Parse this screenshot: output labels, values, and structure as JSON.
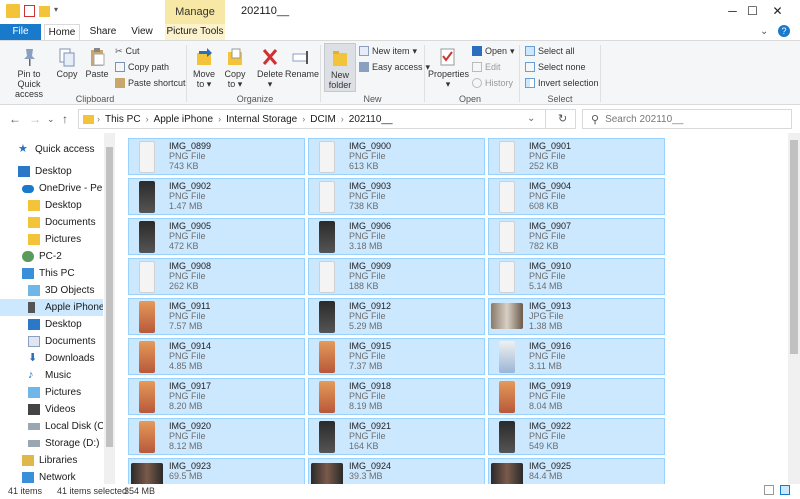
{
  "titlebar": {
    "context_group": "Manage",
    "title": "202110__",
    "minimize": "─",
    "maximize": "☐",
    "close": "✕"
  },
  "tabs": {
    "file": "File",
    "home": "Home",
    "share": "Share",
    "view": "View",
    "picture_tools": "Picture Tools"
  },
  "ribbon": {
    "clipboard": {
      "pin": "Pin to Quick access",
      "copy": "Copy",
      "paste": "Paste",
      "cut": "Cut",
      "copy_path": "Copy path",
      "paste_shortcut": "Paste shortcut",
      "title": "Clipboard"
    },
    "organize": {
      "move_to": "Move to",
      "copy_to": "Copy to",
      "delete": "Delete",
      "rename": "Rename",
      "title": "Organize"
    },
    "new": {
      "new_folder": "New folder",
      "new_item": "New item",
      "easy_access": "Easy access",
      "title": "New"
    },
    "open": {
      "properties": "Properties",
      "open": "Open",
      "edit": "Edit",
      "history": "History",
      "title": "Open"
    },
    "select": {
      "select_all": "Select all",
      "select_none": "Select none",
      "invert": "Invert selection",
      "title": "Select"
    }
  },
  "address": {
    "crumbs": [
      "This PC",
      "Apple iPhone",
      "Internal Storage",
      "DCIM",
      "202110__"
    ],
    "search_placeholder": "Search 202110__"
  },
  "navpane": {
    "items": [
      "Quick access",
      "Desktop",
      "OneDrive - Person",
      "Desktop",
      "Documents",
      "Pictures",
      "PC-2",
      "This PC",
      "3D Objects",
      "Apple iPhone",
      "Desktop",
      "Documents",
      "Downloads",
      "Music",
      "Pictures",
      "Videos",
      "Local Disk (C:)",
      "Storage (D:)",
      "Libraries",
      "Network"
    ]
  },
  "files": [
    {
      "name": "IMG_0899",
      "type": "PNG File",
      "size": "743 KB"
    },
    {
      "name": "IMG_0900",
      "type": "PNG File",
      "size": "613 KB"
    },
    {
      "name": "IMG_0901",
      "type": "PNG File",
      "size": "252 KB"
    },
    {
      "name": "IMG_0902",
      "type": "PNG File",
      "size": "1.47 MB"
    },
    {
      "name": "IMG_0903",
      "type": "PNG File",
      "size": "738 KB"
    },
    {
      "name": "IMG_0904",
      "type": "PNG File",
      "size": "608 KB"
    },
    {
      "name": "IMG_0905",
      "type": "PNG File",
      "size": "472 KB"
    },
    {
      "name": "IMG_0906",
      "type": "PNG File",
      "size": "3.18 MB"
    },
    {
      "name": "IMG_0907",
      "type": "PNG File",
      "size": "782 KB"
    },
    {
      "name": "IMG_0908",
      "type": "PNG File",
      "size": "262 KB"
    },
    {
      "name": "IMG_0909",
      "type": "PNG File",
      "size": "188 KB"
    },
    {
      "name": "IMG_0910",
      "type": "PNG File",
      "size": "5.14 MB"
    },
    {
      "name": "IMG_0911",
      "type": "PNG File",
      "size": "7.57 MB"
    },
    {
      "name": "IMG_0912",
      "type": "PNG File",
      "size": "5.29 MB"
    },
    {
      "name": "IMG_0913",
      "type": "JPG File",
      "size": "1.38 MB"
    },
    {
      "name": "IMG_0914",
      "type": "PNG File",
      "size": "4.85 MB"
    },
    {
      "name": "IMG_0915",
      "type": "PNG File",
      "size": "7.37 MB"
    },
    {
      "name": "IMG_0916",
      "type": "PNG File",
      "size": "3.11 MB"
    },
    {
      "name": "IMG_0917",
      "type": "PNG File",
      "size": "8.20 MB"
    },
    {
      "name": "IMG_0918",
      "type": "PNG File",
      "size": "8.19 MB"
    },
    {
      "name": "IMG_0919",
      "type": "PNG File",
      "size": "8.04 MB"
    },
    {
      "name": "IMG_0920",
      "type": "PNG File",
      "size": "8.12 MB"
    },
    {
      "name": "IMG_0921",
      "type": "PNG File",
      "size": "164 KB"
    },
    {
      "name": "IMG_0922",
      "type": "PNG File",
      "size": "549 KB"
    },
    {
      "name": "IMG_0923",
      "type": "",
      "size": "69.5 MB"
    },
    {
      "name": "IMG_0924",
      "type": "",
      "size": "39.3 MB"
    },
    {
      "name": "IMG_0925",
      "type": "",
      "size": "84.4 MB"
    }
  ],
  "status": {
    "count": "41 items",
    "selected": "41 items selected",
    "size": "354 MB"
  },
  "colors": {
    "accent": "#1979ca",
    "selection": "#cce8ff",
    "selection_border": "#99d1ff",
    "context_tab": "#f7e9a5"
  }
}
